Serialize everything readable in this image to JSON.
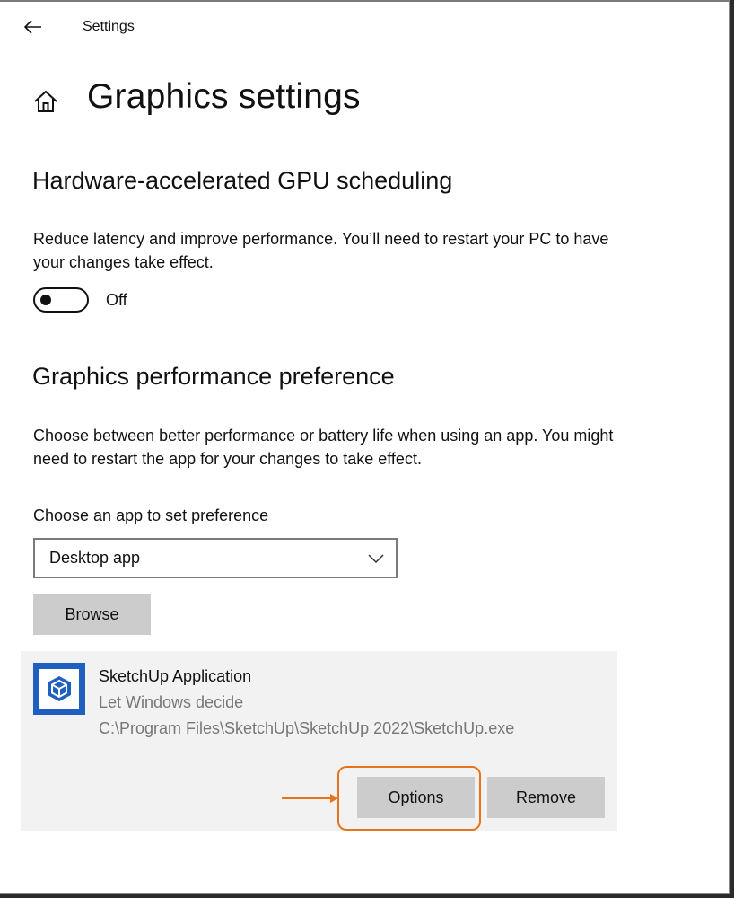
{
  "window": {
    "title": "Settings"
  },
  "page": {
    "title": "Graphics settings"
  },
  "gpu_scheduling": {
    "heading": "Hardware-accelerated GPU scheduling",
    "description": "Reduce latency and improve performance. You’ll need to restart your PC to have your changes take effect.",
    "toggle_state": "Off",
    "toggle_on": false
  },
  "performance_preference": {
    "heading": "Graphics performance preference",
    "description": "Choose between better performance or battery life when using an app. You might need to restart the app for your changes to take effect.",
    "chooser_label": "Choose an app to set preference",
    "dropdown_value": "Desktop app",
    "browse_label": "Browse"
  },
  "app_entry": {
    "name": "SketchUp Application",
    "preference": "Let Windows decide",
    "path": "C:\\Program Files\\SketchUp\\SketchUp 2022\\SketchUp.exe",
    "options_label": "Options",
    "remove_label": "Remove",
    "icon": "sketchup-icon"
  },
  "colors": {
    "accent_annotation": "#e8731a",
    "button_bg": "#cccccc",
    "card_bg": "#f2f2f2",
    "sketchup_blue": "#1e5fbf"
  },
  "icons": {
    "back": "back-arrow-icon",
    "home": "home-icon",
    "dropdown": "chevron-down-icon",
    "annotation": "annotation-arrow-icon"
  }
}
